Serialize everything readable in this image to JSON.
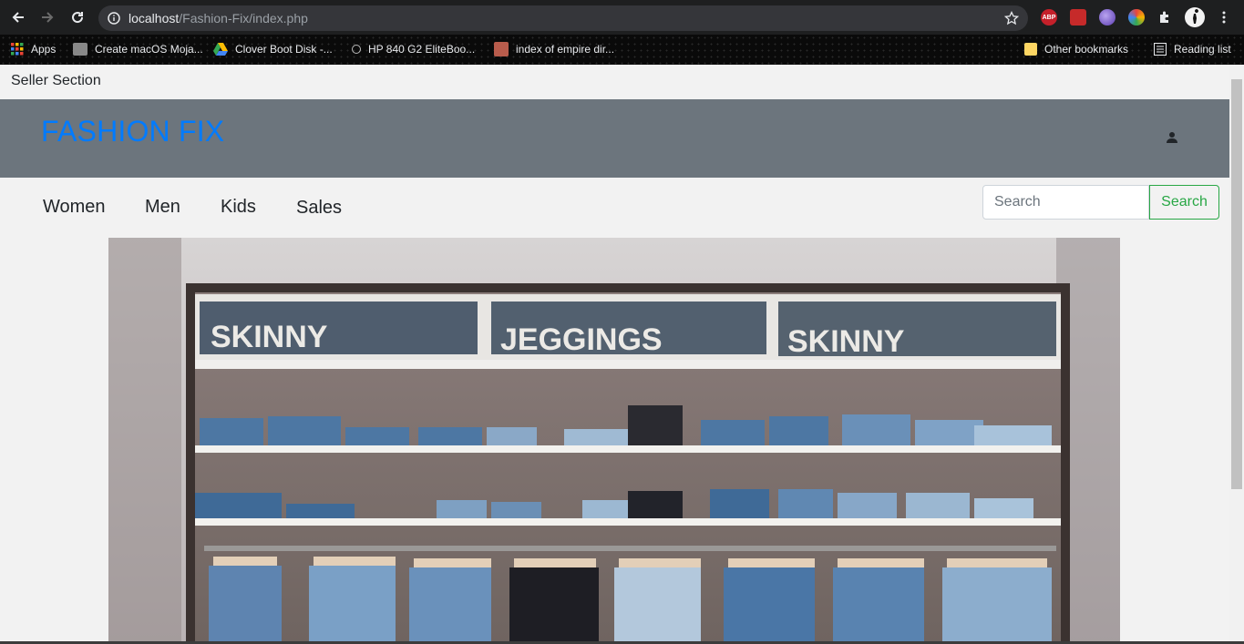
{
  "browser": {
    "url_host": "localhost",
    "url_path": "/Fashion-Fix/index.php",
    "bookmarks": [
      {
        "label": "Apps"
      },
      {
        "label": "Create macOS Moja..."
      },
      {
        "label": "Clover Boot Disk -..."
      },
      {
        "label": "HP 840 G2 EliteBoo..."
      },
      {
        "label": "index of empire dir..."
      }
    ],
    "other_bookmarks": "Other bookmarks",
    "reading_list": "Reading list",
    "ext_abp": "ABP"
  },
  "page": {
    "seller_section": "Seller Section",
    "brand": "FASHION FIX",
    "nav": [
      "Women",
      "Men",
      "Kids",
      "Sales"
    ],
    "search": {
      "placeholder": "Search",
      "button": "Search"
    },
    "hero_signs": [
      "SKINNY",
      "JEGGINGS",
      "SKINNY"
    ]
  },
  "colors": {
    "brand": "#007bff",
    "header_bg": "#6c757d",
    "search_green": "#28a745"
  }
}
